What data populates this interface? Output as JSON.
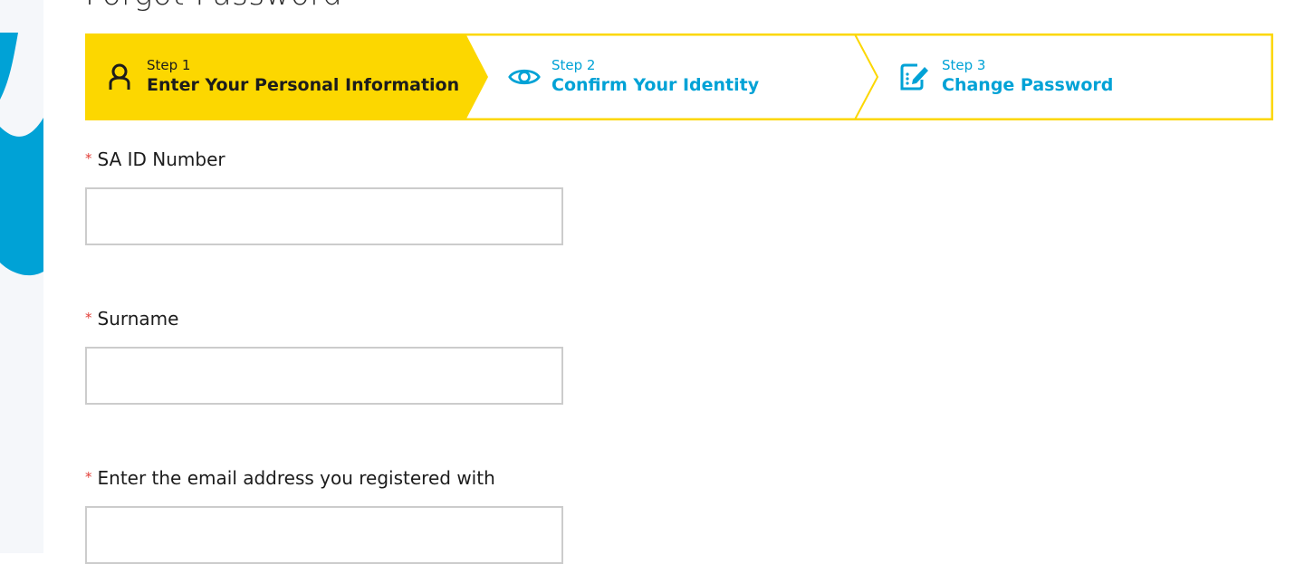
{
  "page": {
    "title": "Forgot Password"
  },
  "stepper": {
    "active_color": "#fcd700",
    "accent_color": "#00a2d6",
    "steps": [
      {
        "number_label": "Step 1",
        "title": "Enter Your Personal Information",
        "icon": "person-icon",
        "active": true
      },
      {
        "number_label": "Step 2",
        "title": "Confirm Your Identity",
        "icon": "eye-icon",
        "active": false
      },
      {
        "number_label": "Step 3",
        "title": "Change Password",
        "icon": "edit-document-icon",
        "active": false
      }
    ]
  },
  "form": {
    "required_marker": "*",
    "fields": [
      {
        "label": "SA ID Number",
        "value": "",
        "placeholder": ""
      },
      {
        "label": "Surname",
        "value": "",
        "placeholder": ""
      },
      {
        "label": "Enter the email address you registered with",
        "value": "",
        "placeholder": ""
      }
    ]
  }
}
